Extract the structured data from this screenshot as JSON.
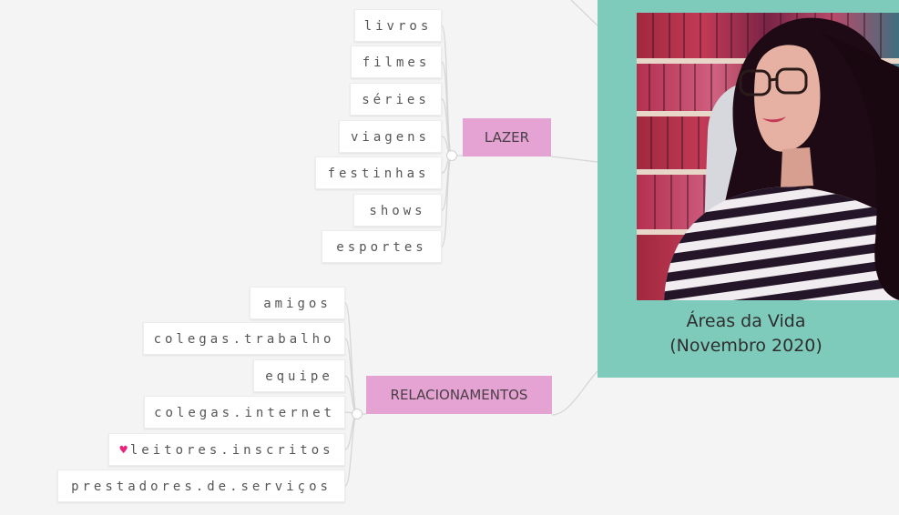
{
  "central": {
    "title_line1": "Áreas da Vida",
    "title_line2": "(Novembro 2020)",
    "panel_color": "#7fcbbb",
    "photo_icon": "portrait-photo"
  },
  "branches": {
    "lazer": {
      "label": "LAZER",
      "color": "#e4a3d2",
      "items": [
        "livros",
        "filmes",
        "séries",
        "viagens",
        "festinhas",
        "shows",
        "esportes"
      ]
    },
    "relacionamentos": {
      "label": "RELACIONAMENTOS",
      "color": "#e4a3d2",
      "items": [
        "amigos",
        "colegas.trabalho",
        "equipe",
        "colegas.internet",
        "leitores.inscritos",
        "prestadores.de.serviços"
      ],
      "heart_icon": "heart-icon",
      "heart_color": "#e8247f"
    }
  }
}
